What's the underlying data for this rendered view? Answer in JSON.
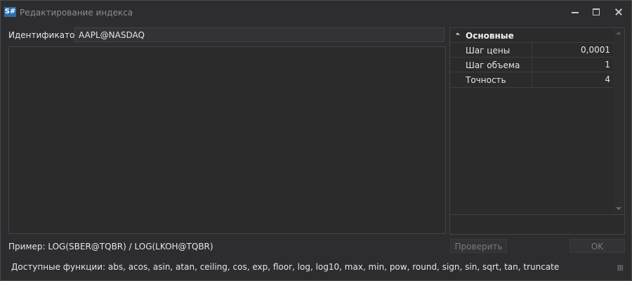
{
  "window": {
    "title": "Редактирование индекса",
    "app_icon_text": "S#",
    "controls": [
      "minimize-icon",
      "maximize-icon",
      "close-icon"
    ]
  },
  "identifier": {
    "label": "Идентификатор:",
    "value": "AAPL@NASDAQ"
  },
  "properties": {
    "category": "Основные",
    "rows": [
      {
        "name": "Шаг цены",
        "value": "0,0001"
      },
      {
        "name": "Шаг объема",
        "value": "1"
      },
      {
        "name": "Точность",
        "value": "4"
      }
    ]
  },
  "example_text": "Пример: LOG(SBER@TQBR) / LOG(LKOH@TQBR)",
  "buttons": {
    "check": "Проверить",
    "ok": "OK"
  },
  "functions_text": "Доступные функции: abs, acos, asin, atan, ceiling, cos, exp, floor, log, log10, max, min, pow, round, sign, sin, sqrt, tan, truncate",
  "colors": {
    "background": "#2d2d30",
    "text": "#e6e6e6",
    "app_icon": "#2c6fa8",
    "disabled_text": "#7a7a7c"
  }
}
